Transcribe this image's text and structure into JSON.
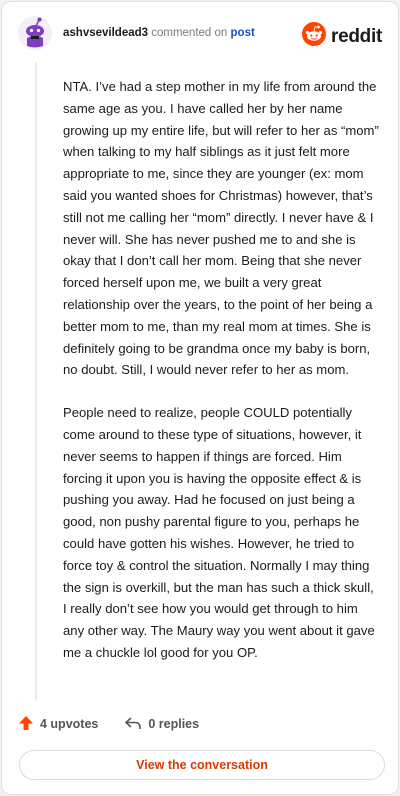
{
  "header": {
    "username": "ashvsevildead3",
    "commented_on": "commented on",
    "post_link": "post",
    "logo_text": "reddit"
  },
  "comment": {
    "paragraphs": [
      "NTA. I’ve had a step mother in my life from around the same age as you. I have called her by her name growing up my entire life, but will refer to her as “mom” when talking to my half siblings as it just felt more appropriate to me, since they are younger (ex: mom said you wanted shoes for Christmas) however, that’s still not me calling her “mom” directly. I never have & I never will. She has never pushed me to and she is okay that I don’t call her mom. Being that she never forced herself upon me, we built a very great relationship over the years, to the point of her being a better mom to me, than my real mom at times. She is definitely going to be grandma once my baby is born, no doubt. Still, I would never refer to her as mom.",
      "People need to realize, people COULD potentially come around to these type of situations, however, it never seems to happen if things are forced. Him forcing it upon you is having the opposite effect & is pushing you away. Had he focused on just being a good, non pushy parental figure to you, perhaps he could have gotten his wishes. However, he tried to force toy & control the situation. Normally I may thing the sign is overkill, but the man has such a thick skull, I really don’t see how you would get through to him any other way. The Maury way you went about it gave me a chuckle lol good for you OP."
    ]
  },
  "actions": {
    "upvotes": "4 upvotes",
    "replies": "0 replies"
  },
  "footer": {
    "view_button": "View the conversation"
  },
  "colors": {
    "brand": "#ff4500",
    "link": "#1a4ec2",
    "button_text": "#d93a00",
    "avatar_purple": "#7e3fbf"
  },
  "icons": {
    "avatar": "snoo-avatar-icon",
    "logo": "reddit-logo-icon",
    "upvote": "upvote-arrow-icon",
    "reply": "reply-arrow-icon"
  }
}
